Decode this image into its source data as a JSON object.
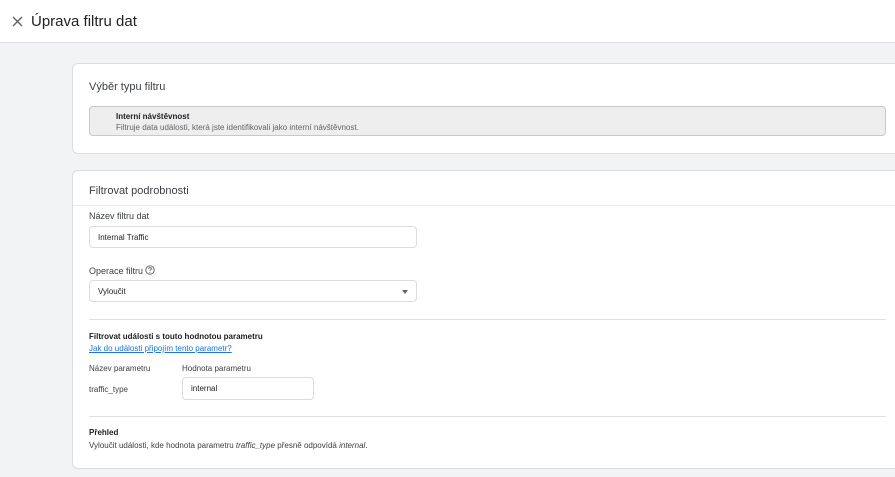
{
  "header": {
    "close_icon": "close-icon",
    "title": "Úprava filtru dat"
  },
  "filter_type": {
    "heading": "Výběr typu filtru",
    "option_title": "Interní návštěvnost",
    "option_description": "Filtruje data události, která jste identifikovali jako interní návštěvnost."
  },
  "details": {
    "heading": "Filtrovat podrobnosti",
    "name_label": "Název filtru dat",
    "name_value": "Internal Traffic",
    "operation_label": "Operace filtru",
    "help_icon": "help-circle-icon",
    "operation_value": "Vyloučit",
    "param_heading": "Filtrovat události s touto hodnotou parametru",
    "param_link": "Jak do události připojím tento parametr?",
    "param_name_col": "Název parametru",
    "param_value_col": "Hodnota parametru",
    "param_name": "traffic_type",
    "param_value": "internal"
  },
  "overview": {
    "heading": "Přehled",
    "text_part1": "Vyloučit události, kde hodnota parametru ",
    "param_italic": "traffic_type",
    "text_part2": " přesně odpovídá ",
    "value_italic": "internal",
    "text_end": "."
  }
}
